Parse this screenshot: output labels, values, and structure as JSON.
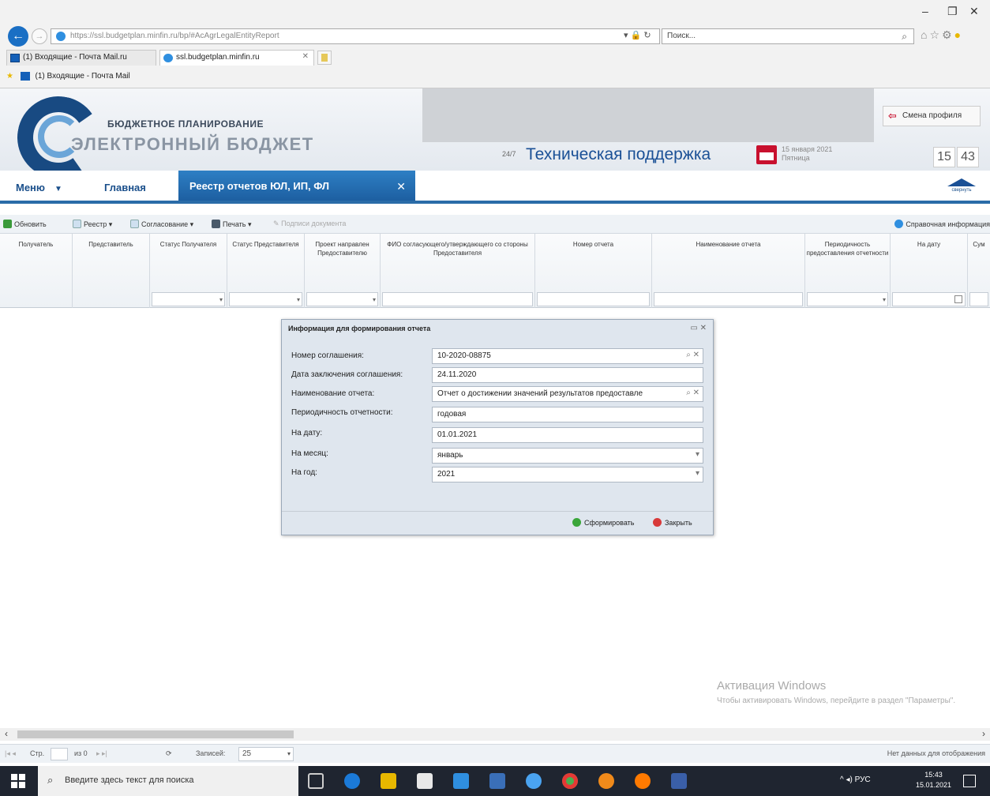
{
  "browser": {
    "address_url": "https://ssl.budgetplan.minfin.ru/bp/#AcAgrLegalEntityReport",
    "address_host": "budgetplan.minfin.ru",
    "search_placeholder": "Поиск...",
    "tabs": [
      {
        "label": "(1) Входящие - Почта Mail.ru"
      },
      {
        "label": "ssl.budgetplan.minfin.ru"
      }
    ],
    "favorites": [
      {
        "label": "(1) Входящие - Почта Mail"
      }
    ]
  },
  "header": {
    "logo_top": "БЮДЖЕТНОЕ ПЛАНИРОВАНИЕ",
    "logo_main": "ЭЛЕКТРОННЫЙ БЮДЖЕТ",
    "support_badge": "24/7",
    "support_text": "Техническая поддержка",
    "date_line1": "15 января 2021",
    "date_line2": "Пятница",
    "profile_button": "Смена профиля",
    "clock_hours": "15",
    "clock_minutes": "43"
  },
  "nav": {
    "menu": "Меню",
    "home": "Главная",
    "active_tab": "Реестр отчетов ЮЛ, ИП, ФЛ",
    "collapse_label": "свернуть"
  },
  "toolbar": {
    "refresh": "Обновить",
    "registry": "Реестр",
    "approval": "Согласование",
    "print": "Печать",
    "sign": "Подписи документа",
    "help": "Справочная информация"
  },
  "grid": {
    "columns": [
      "Получатель",
      "Представитель",
      "Статус Получателя",
      "Статус Представителя",
      "Проект направлен Предоставителю",
      "ФИО согласующего/утверждающего со стороны Предоставителя",
      "Номер отчета",
      "Наименование отчета",
      "Периодичность предоставления отчетности",
      "На дату",
      "Сум"
    ]
  },
  "dialog": {
    "title": "Информация для формирования отчета",
    "fields": [
      {
        "label": "Номер соглашения:",
        "value": "10-2020-08875"
      },
      {
        "label": "Дата заключения соглашения:",
        "value": "24.11.2020"
      },
      {
        "label": "Наименование отчета:",
        "value": "Отчет о достижении значений результатов предоставле"
      },
      {
        "label": "Периодичность отчетности:",
        "value": "годовая"
      },
      {
        "label": "На дату:",
        "value": "01.01.2021"
      },
      {
        "label": "На месяц:",
        "value": "январь"
      },
      {
        "label": "На год:",
        "value": "2021"
      }
    ],
    "submit": "Сформировать",
    "close": "Закрыть"
  },
  "pager": {
    "page_label": "Стр.",
    "of_label": "из 0",
    "records_label": "Записей:",
    "page_size": "25",
    "empty_text": "Нет данных для отображения"
  },
  "activation": {
    "title": "Активация Windows",
    "subtitle": "Чтобы активировать Windows, перейдите в раздел \"Параметры\"."
  },
  "taskbar": {
    "search_placeholder": "Введите здесь текст для поиска",
    "lang": "РУС",
    "time": "15:43",
    "date": "15.01.2021"
  },
  "colors": {
    "brand_blue": "#1a5096",
    "nav_tab": "#2e7fc4",
    "dialog_bg": "#dfe6ee"
  }
}
